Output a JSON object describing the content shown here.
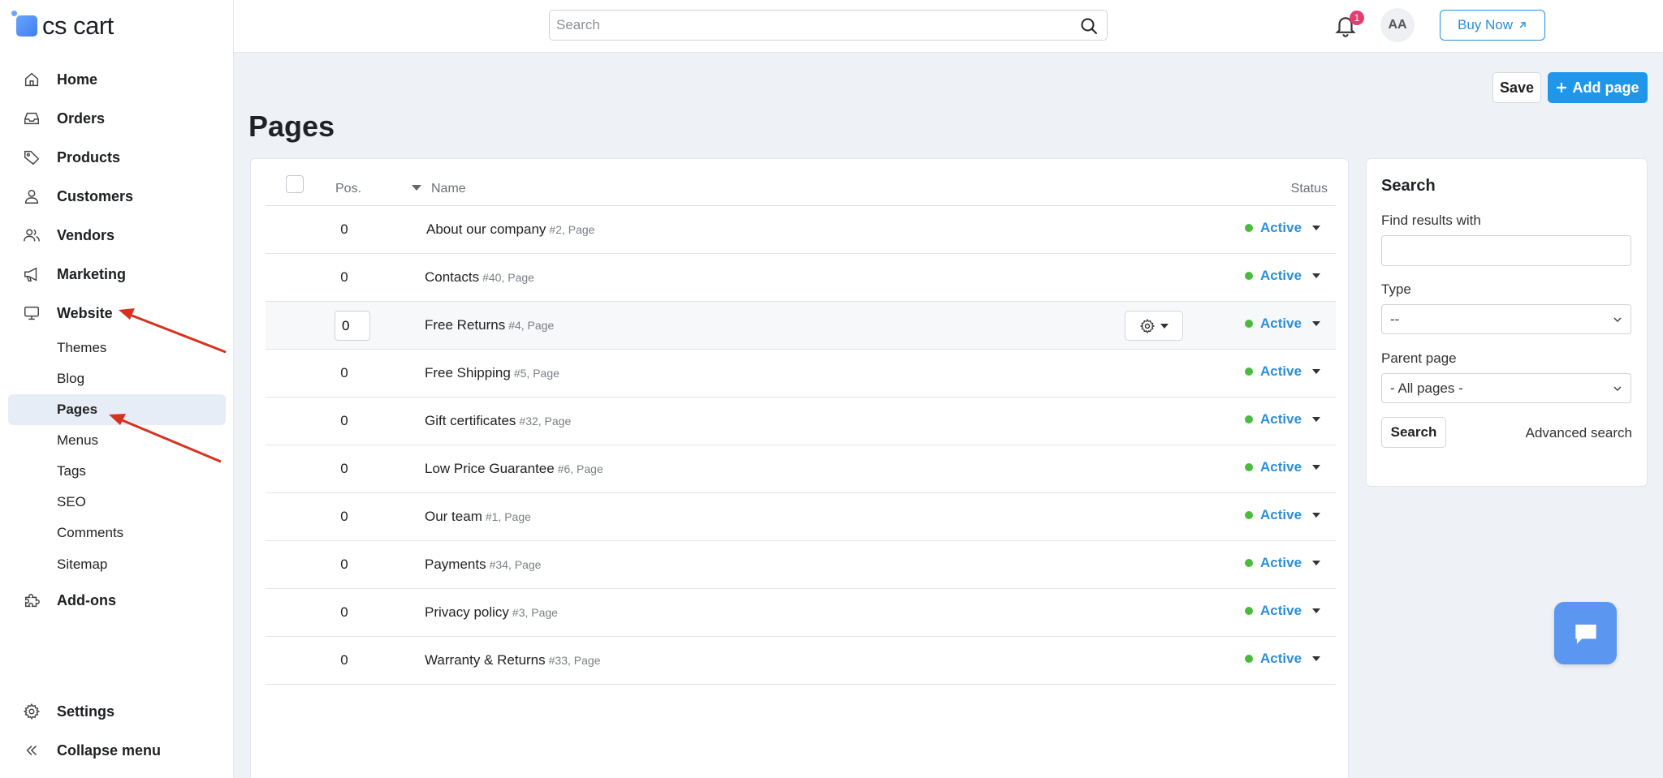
{
  "brand": {
    "name": "cs cart"
  },
  "topbar": {
    "search_placeholder": "Search",
    "buy_label": "Buy Now",
    "notifications_count": "1",
    "avatar_initials": "AA"
  },
  "sidebar": {
    "items": [
      {
        "label": "Home",
        "icon": "home-icon"
      },
      {
        "label": "Orders",
        "icon": "inbox-icon"
      },
      {
        "label": "Products",
        "icon": "tag-icon"
      },
      {
        "label": "Customers",
        "icon": "user-icon"
      },
      {
        "label": "Vendors",
        "icon": "users-icon"
      },
      {
        "label": "Marketing",
        "icon": "megaphone-icon"
      },
      {
        "label": "Website",
        "icon": "monitor-icon"
      }
    ],
    "website_sub": [
      "Themes",
      "Blog",
      "Pages",
      "Menus",
      "Tags",
      "SEO",
      "Comments",
      "Sitemap"
    ],
    "active_sub": "Pages",
    "addons": {
      "label": "Add-ons",
      "icon": "puzzle-icon"
    },
    "settings": {
      "label": "Settings",
      "icon": "gear-icon"
    },
    "collapse": {
      "label": "Collapse menu",
      "icon": "double-chevron-left-icon"
    }
  },
  "actions": {
    "save": "Save",
    "add": "Add page"
  },
  "page_title": "Pages",
  "table": {
    "columns": {
      "pos": "Pos.",
      "name": "Name",
      "status": "Status"
    },
    "rows": [
      {
        "pos": "0",
        "name": "About our company",
        "meta": "#2, Page",
        "status": "Active"
      },
      {
        "pos": "0",
        "name": "Contacts",
        "meta": "#40, Page",
        "status": "Active"
      },
      {
        "pos": "0",
        "name": "Free Returns",
        "meta": "#4, Page",
        "status": "Active"
      },
      {
        "pos": "0",
        "name": "Free Shipping",
        "meta": "#5, Page",
        "status": "Active"
      },
      {
        "pos": "0",
        "name": "Gift certificates",
        "meta": "#32, Page",
        "status": "Active"
      },
      {
        "pos": "0",
        "name": "Low Price Guarantee",
        "meta": "#6, Page",
        "status": "Active"
      },
      {
        "pos": "0",
        "name": "Our team",
        "meta": "#1, Page",
        "status": "Active"
      },
      {
        "pos": "0",
        "name": "Payments",
        "meta": "#34, Page",
        "status": "Active"
      },
      {
        "pos": "0",
        "name": "Privacy policy",
        "meta": "#3, Page",
        "status": "Active"
      },
      {
        "pos": "0",
        "name": "Warranty & Returns",
        "meta": "#33, Page",
        "status": "Active"
      }
    ]
  },
  "search_panel": {
    "title": "Search",
    "find_label": "Find results with",
    "find_value": "",
    "type_label": "Type",
    "type_value": "--",
    "parent_label": "Parent page",
    "parent_value": "- All pages -",
    "search_button": "Search",
    "advanced_link": "Advanced search"
  },
  "colors": {
    "accent": "#1e97ea",
    "link": "#2a8fd8",
    "status_active": "#4bbb3e",
    "badge": "#e63d6f",
    "annotation_arrow": "#d6331f"
  }
}
